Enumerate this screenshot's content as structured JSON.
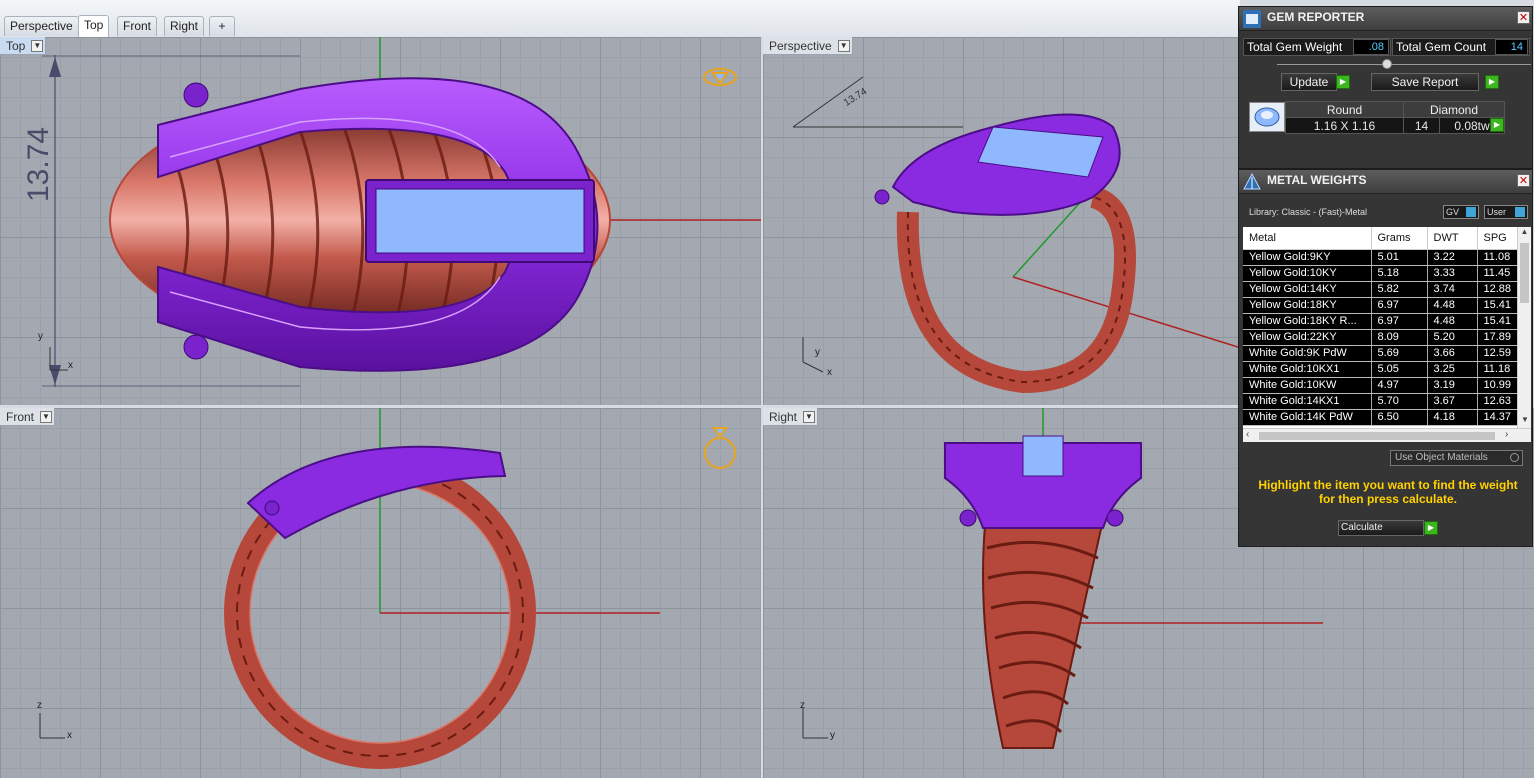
{
  "tabs": [
    {
      "label": "Perspective",
      "active": false
    },
    {
      "label": "Top",
      "active": true
    },
    {
      "label": "Front",
      "active": false
    },
    {
      "label": "Right",
      "active": false
    },
    {
      "label": "+",
      "active": false
    }
  ],
  "viewports": {
    "top": {
      "label": "Top",
      "dimension": "13.74",
      "axis_y": "y",
      "axis_x": "x"
    },
    "perspective": {
      "label": "Perspective",
      "dimension": "13.74",
      "axis_y": "y",
      "axis_x": "x"
    },
    "front": {
      "label": "Front",
      "axis_z": "z",
      "axis_x": "x"
    },
    "right": {
      "label": "Right",
      "axis_z": "z",
      "axis_y": "y"
    }
  },
  "gem_reporter": {
    "title": "GEM REPORTER",
    "total_weight_label": "Total Gem Weight",
    "total_weight_value": ".08",
    "total_count_label": "Total Gem Count",
    "total_count_value": "14",
    "update_label": "Update",
    "save_label": "Save Report",
    "table_header": {
      "shape": "Round",
      "type": "Diamond"
    },
    "table_row": {
      "size": "1.16 X 1.16",
      "count": "14",
      "weight": "0.08tw"
    }
  },
  "metal_weights": {
    "title": "METAL WEIGHTS",
    "library": "Library: Classic - (Fast)-Metal",
    "gv_label": "GV",
    "user_label": "User",
    "columns": [
      "Metal",
      "Grams",
      "DWT",
      "SPG"
    ],
    "rows": [
      {
        "metal": "Yellow Gold:9KY",
        "grams": "5.01",
        "dwt": "3.22",
        "spg": "11.08"
      },
      {
        "metal": "Yellow Gold:10KY",
        "grams": "5.18",
        "dwt": "3.33",
        "spg": "11.45"
      },
      {
        "metal": "Yellow Gold:14KY",
        "grams": "5.82",
        "dwt": "3.74",
        "spg": "12.88"
      },
      {
        "metal": "Yellow Gold:18KY",
        "grams": "6.97",
        "dwt": "4.48",
        "spg": "15.41"
      },
      {
        "metal": "Yellow Gold:18KY R...",
        "grams": "6.97",
        "dwt": "4.48",
        "spg": "15.41"
      },
      {
        "metal": "Yellow Gold:22KY",
        "grams": "8.09",
        "dwt": "5.20",
        "spg": "17.89"
      },
      {
        "metal": "White Gold:9K PdW",
        "grams": "5.69",
        "dwt": "3.66",
        "spg": "12.59"
      },
      {
        "metal": "White Gold:10KX1",
        "grams": "5.05",
        "dwt": "3.25",
        "spg": "11.18"
      },
      {
        "metal": "White Gold:10KW",
        "grams": "4.97",
        "dwt": "3.19",
        "spg": "10.99"
      },
      {
        "metal": "White Gold:14KX1",
        "grams": "5.70",
        "dwt": "3.67",
        "spg": "12.63"
      },
      {
        "metal": "White Gold:14K PdW",
        "grams": "6.50",
        "dwt": "4.18",
        "spg": "14.37"
      }
    ],
    "use_materials_label": "Use Object Materials",
    "hint": "Highlight the item you want to find the weight for then press calculate.",
    "calculate_label": "Calculate"
  },
  "colors": {
    "metal_purple": "#8a2be2",
    "shank_red": "#b5483a",
    "gem_blue": "#8fb8ff",
    "hint_yellow": "#ffd200",
    "axis_red": "#b02020",
    "axis_green": "#1f9a2a"
  }
}
